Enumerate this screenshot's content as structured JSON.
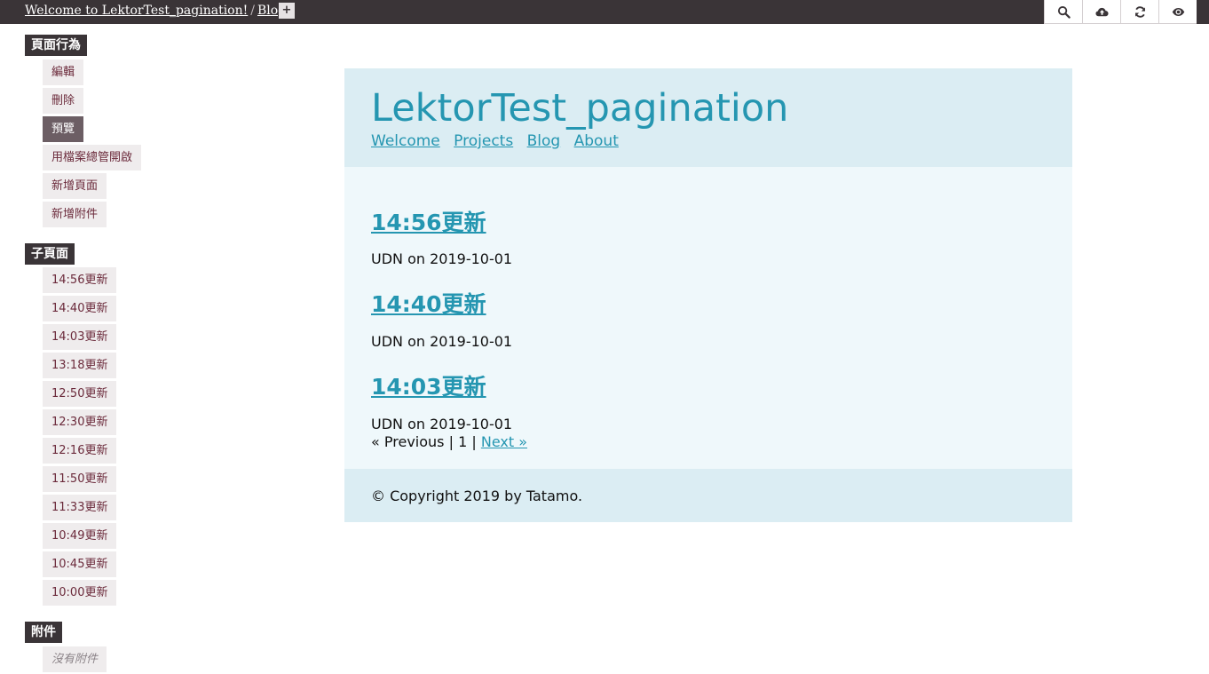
{
  "breadcrumb": {
    "home": "Welcome to LektorTest_pagination!",
    "separator": "/",
    "current": "Blog",
    "add_symbol": "+"
  },
  "toolbar": {
    "icons": [
      "search-icon",
      "cloud-upload-icon",
      "refresh-icon",
      "eye-icon"
    ]
  },
  "sidebar": {
    "actions_heading": "頁面行為",
    "actions": [
      {
        "label": "編輯"
      },
      {
        "label": "刪除"
      },
      {
        "label": "預覽"
      },
      {
        "label": "用檔案總管開啟"
      },
      {
        "label": "新增頁面"
      },
      {
        "label": "新增附件"
      }
    ],
    "children_heading": "子頁面",
    "children": [
      {
        "label": "14:56更新"
      },
      {
        "label": "14:40更新"
      },
      {
        "label": "14:03更新"
      },
      {
        "label": "13:18更新"
      },
      {
        "label": "12:50更新"
      },
      {
        "label": "12:30更新"
      },
      {
        "label": "12:16更新"
      },
      {
        "label": "11:50更新"
      },
      {
        "label": "11:33更新"
      },
      {
        "label": "10:49更新"
      },
      {
        "label": "10:45更新"
      },
      {
        "label": "10:00更新"
      }
    ],
    "attachments_heading": "附件",
    "attachments_empty": "沒有附件"
  },
  "preview": {
    "site_title": "LektorTest_pagination",
    "nav": [
      "Welcome",
      "Projects",
      "Blog",
      "About"
    ],
    "posts": [
      {
        "title": "14:56更新",
        "meta": "UDN on 2019-10-01"
      },
      {
        "title": "14:40更新",
        "meta": "UDN on 2019-10-01"
      },
      {
        "title": "14:03更新",
        "meta": "UDN on 2019-10-01"
      }
    ],
    "pagination": {
      "previous": "« Previous",
      "divider": "|",
      "page": "1",
      "next": "Next »"
    },
    "footer": "© Copyright 2019 by Tatamo."
  },
  "colors": {
    "topbar": "#3a3437",
    "accent": "#2596b1",
    "sidebar_item_text": "#6b2a3b",
    "active_item": "#6c5e64"
  }
}
